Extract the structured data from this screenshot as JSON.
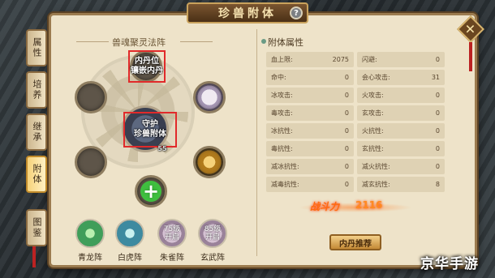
{
  "panel": {
    "title": "珍兽附体",
    "help_icon": "?",
    "close_icon": "✕"
  },
  "side_tabs": [
    {
      "label": "属性",
      "active": false
    },
    {
      "label": "培养",
      "active": false
    },
    {
      "label": "继承",
      "active": false
    },
    {
      "label": "附体",
      "active": true
    },
    {
      "label": "图鉴",
      "active": false
    }
  ],
  "left": {
    "section_title": "兽魂聚灵法阵",
    "top_slot_text": "内丹位\n镶嵌内丹",
    "center_text": "守护\n珍兽附体",
    "center_sub": "55"
  },
  "formations": [
    {
      "label": "青龙阵",
      "color": "#3f9e5a",
      "locked": false,
      "lock_text": ""
    },
    {
      "label": "白虎阵",
      "color": "#3d8aa0",
      "locked": false,
      "lock_text": ""
    },
    {
      "label": "朱雀阵",
      "color": "#b9a0b8",
      "locked": true,
      "lock_text": "75级\n开启"
    },
    {
      "label": "玄武阵",
      "color": "#b9a0b8",
      "locked": true,
      "lock_text": "85级\n开启"
    }
  ],
  "attributes": {
    "title": "附体属性",
    "rows": [
      [
        {
          "name": "血上限:",
          "value": "2075"
        },
        {
          "name": "闪避:",
          "value": "0"
        }
      ],
      [
        {
          "name": "命中:",
          "value": "0"
        },
        {
          "name": "会心攻击:",
          "value": "31"
        }
      ],
      [
        {
          "name": "冰攻击:",
          "value": "0"
        },
        {
          "name": "火攻击:",
          "value": "0"
        }
      ],
      [
        {
          "name": "毒攻击:",
          "value": "0"
        },
        {
          "name": "玄攻击:",
          "value": "0"
        }
      ],
      [
        {
          "name": "冰抗性:",
          "value": "0"
        },
        {
          "name": "火抗性:",
          "value": "0"
        }
      ],
      [
        {
          "name": "毒抗性:",
          "value": "0"
        },
        {
          "name": "玄抗性:",
          "value": "0"
        }
      ],
      [
        {
          "name": "减冰抗性:",
          "value": "0"
        },
        {
          "name": "减火抗性:",
          "value": "0"
        }
      ],
      [
        {
          "name": "减毒抗性:",
          "value": "0"
        },
        {
          "name": "减玄抗性:",
          "value": "8"
        }
      ]
    ]
  },
  "power": {
    "label": "战斗力",
    "value": "2116"
  },
  "recommend_button": "内丹推荐",
  "watermark": "京华手游",
  "colors": {
    "highlight_red": "#e12a2a",
    "power_orange": "#ff6a10",
    "active_tab": "#f6d27a"
  }
}
